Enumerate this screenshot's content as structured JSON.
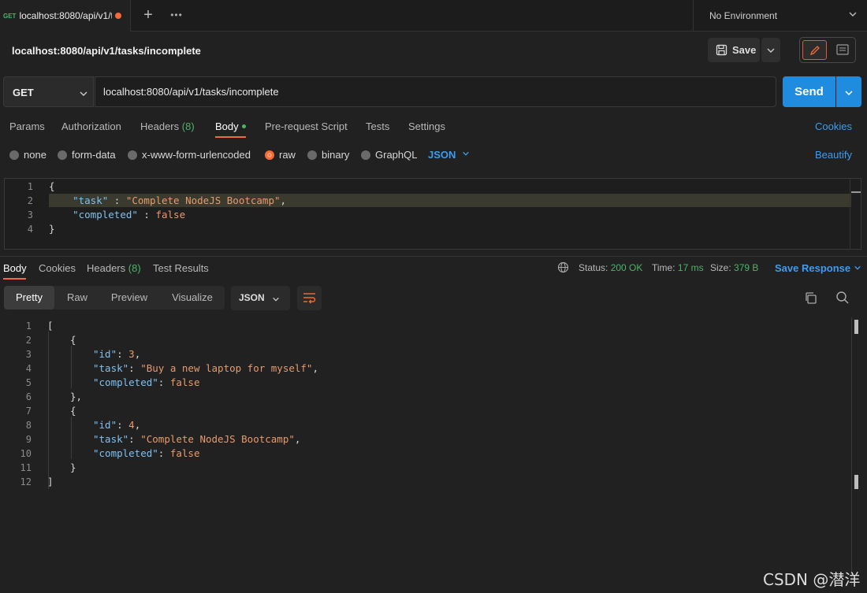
{
  "tab": {
    "method": "GET",
    "title": "localhost:8080/api/v1/t",
    "unsaved": true
  },
  "environment": "No Environment",
  "request": {
    "name": "localhost:8080/api/v1/tasks/incomplete",
    "save_label": "Save",
    "method": "GET",
    "url": "localhost:8080/api/v1/tasks/incomplete",
    "send_label": "Send"
  },
  "request_tabs": {
    "params": "Params",
    "authorization": "Authorization",
    "headers": "Headers",
    "headers_count": "(8)",
    "body": "Body",
    "prerequest": "Pre-request Script",
    "tests": "Tests",
    "settings": "Settings",
    "cookies": "Cookies"
  },
  "body_types": {
    "none": "none",
    "form_data": "form-data",
    "urlencoded": "x-www-form-urlencoded",
    "raw": "raw",
    "binary": "binary",
    "graphql": "GraphQL",
    "format": "JSON",
    "beautify": "Beautify",
    "selected": "raw"
  },
  "request_body": {
    "line_numbers": [
      "1",
      "2",
      "3",
      "4"
    ],
    "l1": "{",
    "l2_key": "\"task\"",
    "l2_sep": " : ",
    "l2_val": "\"Complete NodeJS Bootcamp\"",
    "l2_end": ",",
    "l3_key": "\"completed\"",
    "l3_sep": " : ",
    "l3_val": "false",
    "l4": "}"
  },
  "response_tabs": {
    "body": "Body",
    "cookies": "Cookies",
    "headers": "Headers",
    "headers_count": "(8)",
    "test_results": "Test Results",
    "status_label": "Status:",
    "status_value": "200 OK",
    "time_label": "Time:",
    "time_value": "17 ms",
    "size_label": "Size:",
    "size_value": "379 B",
    "save_response": "Save Response"
  },
  "view_modes": {
    "pretty": "Pretty",
    "raw": "Raw",
    "preview": "Preview",
    "visualize": "Visualize",
    "format": "JSON"
  },
  "response_body": {
    "line_numbers": [
      "1",
      "2",
      "3",
      "4",
      "5",
      "6",
      "7",
      "8",
      "9",
      "10",
      "11",
      "12"
    ],
    "l1": "[",
    "l2": "{",
    "l3_key": "\"id\"",
    "l3_val": "3",
    "l4_key": "\"task\"",
    "l4_val": "\"Buy a new laptop for myself\"",
    "l5_key": "\"completed\"",
    "l5_val": "false",
    "l6": "},",
    "l7": "{",
    "l8_key": "\"id\"",
    "l8_val": "4",
    "l9_key": "\"task\"",
    "l9_val": "\"Complete NodeJS Bootcamp\"",
    "l10_key": "\"completed\"",
    "l10_val": "false",
    "l11": "}",
    "l12": "]"
  },
  "watermark": "CSDN @潜洋",
  "colors": {
    "accent": "#f26b3a",
    "send": "#1f8ce0",
    "link": "#3e9cf0",
    "success": "#4fb26a"
  }
}
